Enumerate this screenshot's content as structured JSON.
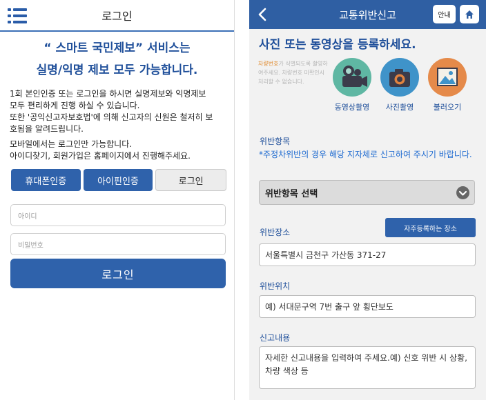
{
  "left": {
    "header": {
      "title": "로그인",
      "menu_icon": "hamburger-menu-icon"
    },
    "headline_line1": "“ 스마트 국민제보” 서비스는",
    "headline_line2": "실명/익명 제보 모두 가능합니다.",
    "body": [
      "1회 본인인증 또는 로그인을 하시면 실명제보와 익명제보",
      "모두 편리하게 진행 하실 수 있습니다.",
      "또한 '공익신고자보호법'에 의해 신고자의 신원은 철저히 보",
      "호됨을 알려드립니다.",
      "모바일에서는 로그인만 가능합니다.",
      "아이디찾기, 회원가입은 홈페이지에서 진행해주세요."
    ],
    "auth_buttons": [
      "휴대폰인증",
      "아이핀인증",
      "로그인"
    ],
    "id_placeholder": "아이디",
    "pw_placeholder": "비밀번호",
    "login_button": "로그인"
  },
  "right": {
    "header": {
      "title": "교통위반신고",
      "guide_button": "안내",
      "back_icon": "back-arrow-icon",
      "home_icon": "home-icon"
    },
    "title": "사진 또는 동영상을 등록하세요.",
    "hint_orange": "차량번호",
    "hint_rest": "가 식별되도록 촬영하여주세요. 차량번호 미확인시 처리할 수 없습니다.",
    "media": [
      {
        "label": "동영상촬영",
        "icon": "video-camera-icon",
        "color": "#5fb7a3"
      },
      {
        "label": "사진촬영",
        "icon": "photo-camera-icon",
        "color": "#3f93c9"
      },
      {
        "label": "불러오기",
        "icon": "gallery-icon",
        "color": "#e58a4a"
      }
    ],
    "violation_label": "위반항목",
    "violation_note": "*주정차위반의 경우 해당 지자체로 신고하여 주시기 바랍니다.",
    "violation_select": "위반항목 선택",
    "place_label": "위반장소",
    "favorite_place_button": "자주등록하는 장소",
    "place_value": "서울특별시 금천구 가산동 371-27",
    "position_label": "위반위치",
    "position_placeholder": "예) 서대문구역 7번 출구 앞 횡단보도",
    "content_label": "신고내용",
    "content_placeholder": "자세한 신고내용을 입력하여 주세요.예) 신호 위반 시 상황, 차량 색상 등"
  },
  "colors": {
    "primary": "#2f62ab",
    "header_blue": "#2f5fa3",
    "text_blue": "#1f4f9a",
    "note_blue": "#1f6bd0"
  }
}
